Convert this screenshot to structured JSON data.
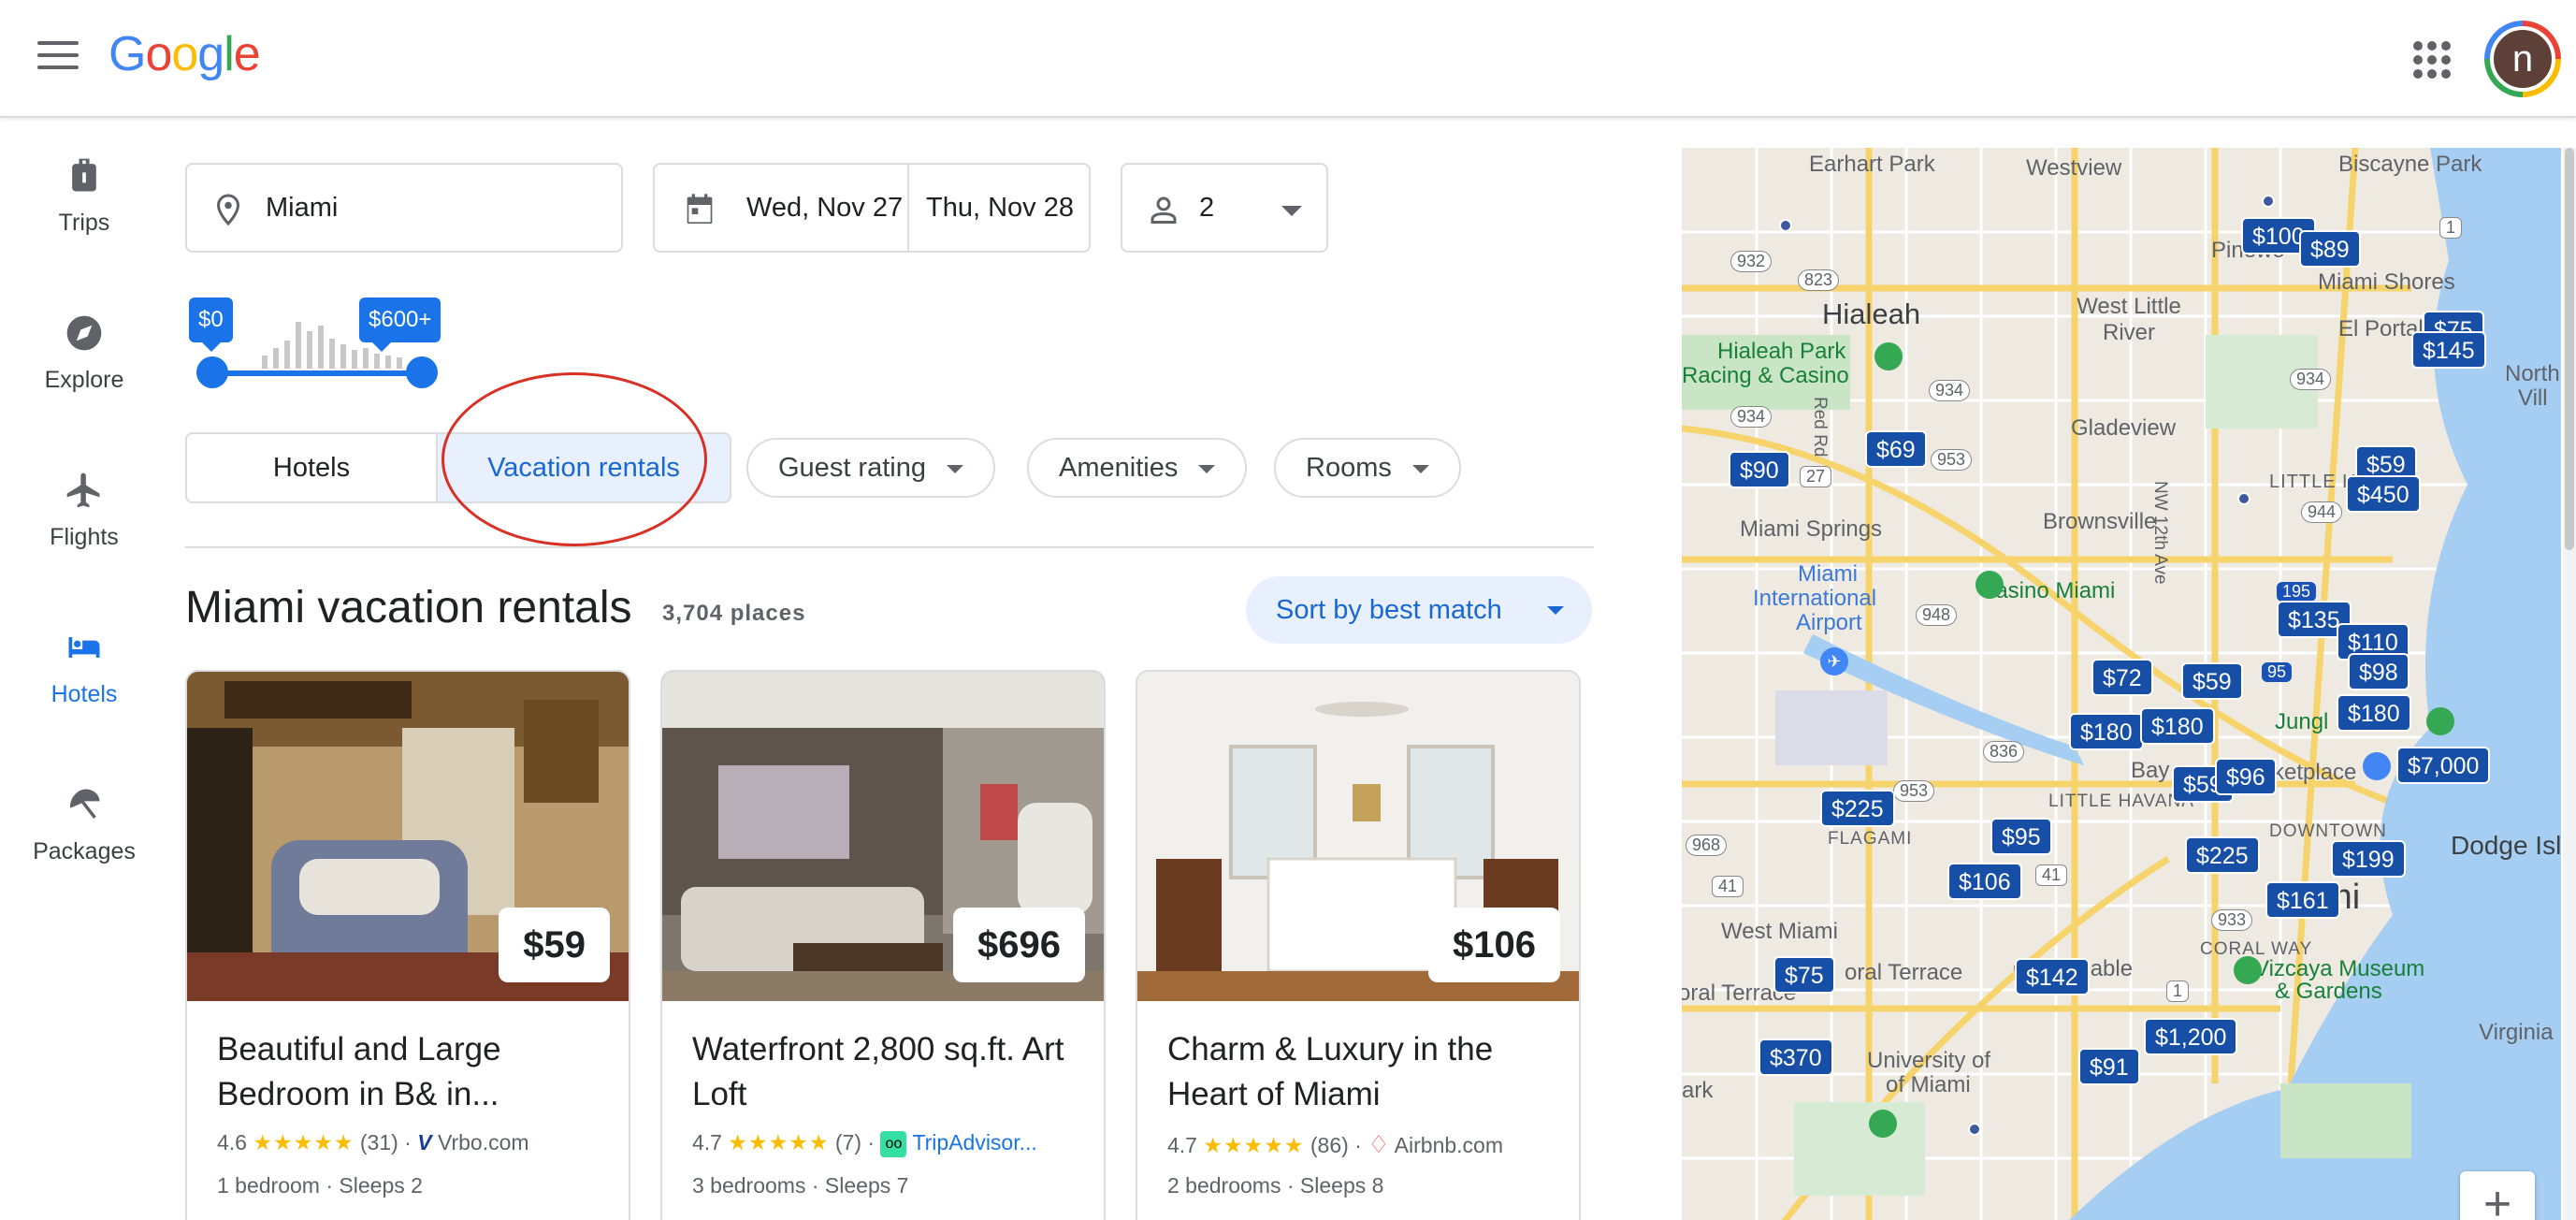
{
  "header": {
    "logo_text": "Google",
    "avatar_letter": "n"
  },
  "nav": {
    "trips": "Trips",
    "explore": "Explore",
    "flights": "Flights",
    "hotels": "Hotels",
    "packages": "Packages"
  },
  "search": {
    "location": "Miami",
    "checkin": "Wed, Nov 27",
    "checkout": "Thu, Nov 28",
    "guests": "2"
  },
  "price_filter": {
    "min_label": "$0",
    "max_label": "$600+"
  },
  "tabs": {
    "hotels": "Hotels",
    "vacation_rentals": "Vacation rentals"
  },
  "filters": {
    "guest_rating": "Guest rating",
    "amenities": "Amenities",
    "rooms": "Rooms"
  },
  "results": {
    "title": "Miami vacation rentals",
    "count": "3,704 places",
    "sort_label": "Sort by best match",
    "listings": [
      {
        "price": "$59",
        "title": "Beautiful and Large Bedroom in B& in...",
        "rating": "4.6",
        "stars": "★★★★★",
        "reviews": "(31)",
        "source": "Vrbo.com",
        "bedrooms": "1 bedroom",
        "sleeps": "Sleeps 2"
      },
      {
        "price": "$696",
        "title": "Waterfront 2,800 sq.ft. Art Loft",
        "rating": "4.7",
        "stars": "★★★★★",
        "reviews": "(7)",
        "source": "TripAdvisor...",
        "bedrooms": "3 bedrooms",
        "sleeps": "Sleeps 7"
      },
      {
        "price": "$106",
        "title": "Charm & Luxury in the Heart of Miami",
        "rating": "4.7",
        "stars": "★★★★★",
        "reviews": "(86)",
        "source": "Airbnb.com",
        "bedrooms": "2 bedrooms",
        "sleeps": "Sleeps 8"
      }
    ]
  },
  "map": {
    "labels": {
      "earhart_park": "Earhart Park",
      "westview": "Westview",
      "biscayne_park": "Biscayne Park",
      "hialeah": "Hialeah",
      "west_little_river": "West Little River",
      "pinewood": "Pinewo",
      "miami_shores": "Miami Shores",
      "el_portal": "El Portal",
      "hialeah_park": "Hialeah Park",
      "racing_casino": "Racing & Casino",
      "gladeview": "Gladeview",
      "north": "North",
      "vill": "Vill",
      "miami_springs": "Miami Springs",
      "brownsville": "Brownsville",
      "little_h": "LITTLE H",
      "miami_intl": "Miami",
      "international": "International",
      "airport": "Airport",
      "casino_miami": "Casino Miami",
      "jungle": "Jungl",
      "bay": "Bay",
      "marketplace": "ketplace",
      "little_havana": "LITTLE HAVANA",
      "flagami": "FLAGAMI",
      "downtown": "DOWNTOWN",
      "dodge_island": "Dodge Islar",
      "miami": "ami",
      "west_miami": "West Miami",
      "coral_gables": "Coral Gable",
      "coral_way": "CORAL WAY",
      "vizcaya": "Vizcaya Museum",
      "gardens": "& Gardens",
      "coral_terrace": "oral Terrace",
      "university_of": "University of",
      "of_miami": "of Miami",
      "virginia": "Virginia",
      "ark": "ark",
      "nw12": "NW 12th Ave",
      "redrd": "Red Rd",
      "r932": "932",
      "r823": "823",
      "r934a": "934",
      "r934b": "934",
      "r934c": "934",
      "r953": "953",
      "r944": "944",
      "r948": "948",
      "r836": "836",
      "r953b": "953",
      "r968": "968",
      "r41a": "41",
      "r41b": "41",
      "r933": "933",
      "r1": "1",
      "r1b": "1",
      "r27": "27",
      "r95": "95",
      "r195": "195"
    },
    "pins": [
      "$100",
      "$89",
      "$75",
      "$145",
      "$90",
      "$69",
      "$59",
      "$450",
      "$135",
      "$110",
      "$98",
      "$72",
      "$59",
      "$180",
      "$180",
      "$180",
      "$7,000",
      "$59",
      "$96",
      "$225",
      "$95",
      "$106",
      "$225",
      "$199",
      "$161",
      "$75",
      "$142",
      "$1,200",
      "$370",
      "$91"
    ]
  }
}
